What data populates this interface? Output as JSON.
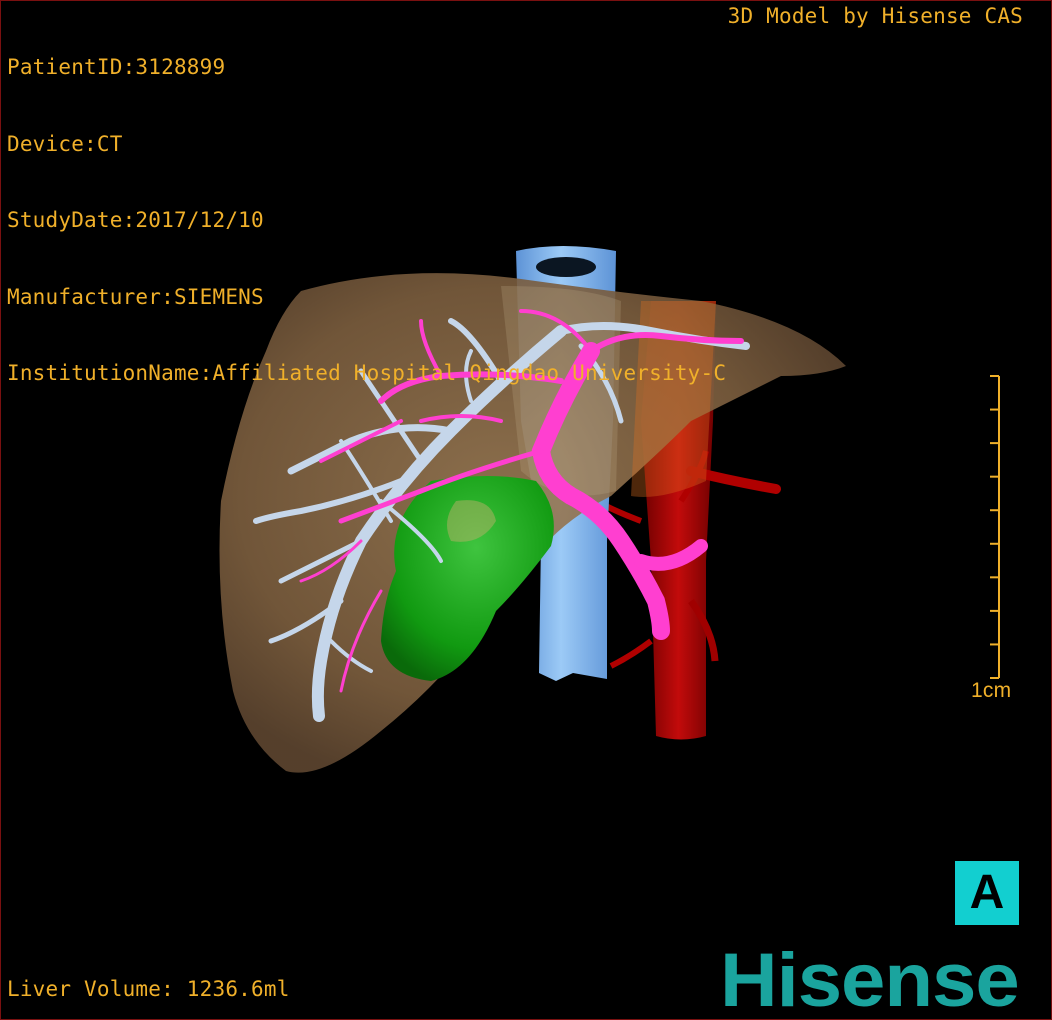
{
  "overlay": {
    "patient_id": "PatientID:3128899",
    "device": "Device:CT",
    "study_date": "StudyDate:2017/12/10",
    "manufacturer": "Manufacturer:SIEMENS",
    "institution": "InstitutionName:Affiliated Hospital Qingdao University-C",
    "model_credit": "3D Model by Hisense CAS",
    "liver_volume": "Liver Volume: 1236.6ml"
  },
  "scale_bar": {
    "label": "1cm",
    "ticks": 10
  },
  "orientation": {
    "label": "A"
  },
  "logo": {
    "text": "Hisense"
  },
  "colors": {
    "text": "#f0b02a",
    "liver": "#8a6a45",
    "hepatic_vein": "#c7d7ee",
    "portal_vein": "#ff3fd0",
    "vena_cava": "#7fb6f2",
    "aorta": "#b00000",
    "tumor": "#119a11",
    "orientation_box": "#12cfd0",
    "logo": "#1aa49e"
  }
}
